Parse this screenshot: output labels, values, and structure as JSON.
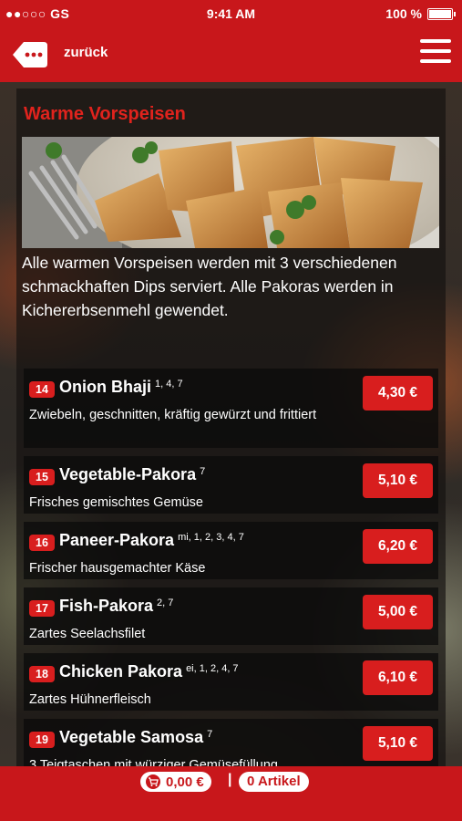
{
  "status_bar": {
    "carrier": "●●○○○ GS",
    "time": "9:41 AM",
    "battery": "100 %"
  },
  "header": {
    "back_label": "zurück",
    "back_icon": "back-bubble-icon",
    "menu_icon": "hamburger-menu-icon"
  },
  "section": {
    "title": "Warme Vorspeisen",
    "description": "Alle warmen Vorspeisen werden mit 3 verschiedenen schmackhaften Dips serviert. Alle Pakoras werden in Kichererbsenmehl gewendet.",
    "image": "samosa-plate-photo"
  },
  "items": [
    {
      "number": "14",
      "name": "Onion Bhaji",
      "allergens": "1, 4, 7",
      "description": "Zwiebeln, geschnitten, kräftig gewürzt und frittiert",
      "price": "4,30 €"
    },
    {
      "number": "15",
      "name": "Vegetable-Pakora",
      "allergens": "7",
      "description": "Frisches gemischtes Gemüse",
      "price": "5,10 €"
    },
    {
      "number": "16",
      "name": "Paneer-Pakora",
      "allergens": "mi, 1, 2, 3, 4, 7",
      "description": "Frischer hausgemachter Käse",
      "price": "6,20 €"
    },
    {
      "number": "17",
      "name": "Fish-Pakora",
      "allergens": "2, 7",
      "description": "Zartes Seelachsfilet",
      "price": "5,00 €"
    },
    {
      "number": "18",
      "name": "Chicken Pakora",
      "allergens": "ei, 1, 2, 4, 7",
      "description": "Zartes Hühnerfleisch",
      "price": "6,10 €"
    },
    {
      "number": "19",
      "name": "Vegetable Samosa",
      "allergens": "7",
      "description": "3 Teigtaschen mit würziger Gemüsefüllung",
      "price": "5,10 €"
    }
  ],
  "footer": {
    "cart_total": "0,00 €",
    "separator": "|",
    "article_count": "0 Artikel",
    "cart_icon": "shopping-cart-icon"
  },
  "colors": {
    "brand_red": "#c8171b",
    "accent_red": "#e0231d",
    "button_red": "#d81e1e"
  }
}
